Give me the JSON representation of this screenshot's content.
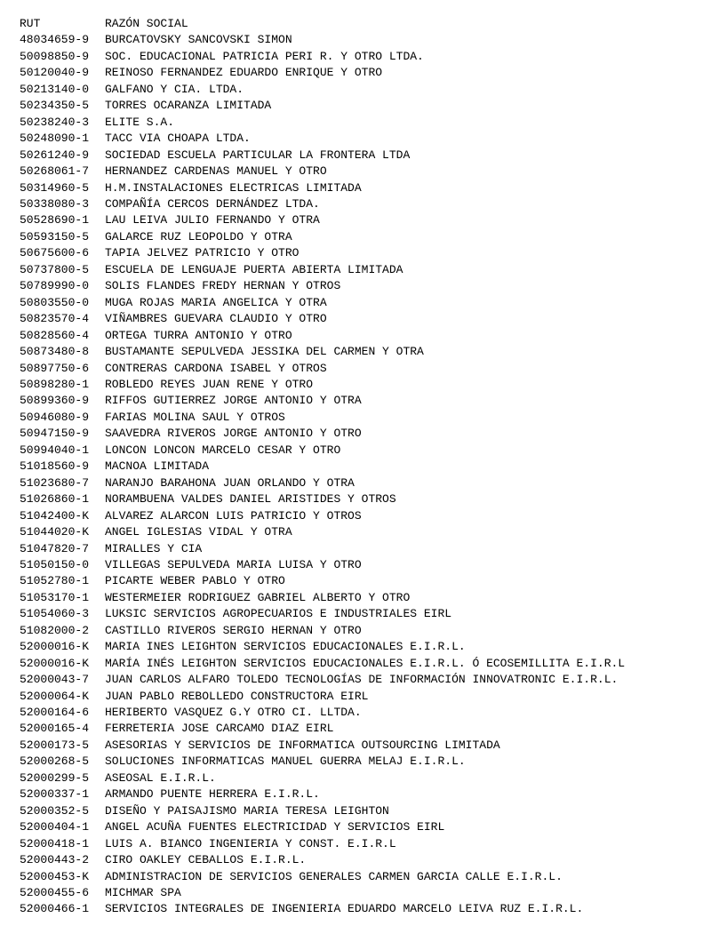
{
  "headers": {
    "rut": "RUT",
    "razon": "RAZÓN SOCIAL"
  },
  "rows": [
    {
      "rut": "48034659-9",
      "razon": "BURCATOVSKY SANCOVSKI SIMON"
    },
    {
      "rut": "50098850-9",
      "razon": "SOC. EDUCACIONAL PATRICIA PERI R. Y OTRO LTDA."
    },
    {
      "rut": "50120040-9",
      "razon": "REINOSO FERNANDEZ EDUARDO ENRIQUE Y OTRO"
    },
    {
      "rut": "50213140-0",
      "razon": "GALFANO Y CIA. LTDA."
    },
    {
      "rut": "50234350-5",
      "razon": "TORRES OCARANZA LIMITADA"
    },
    {
      "rut": "50238240-3",
      "razon": "ELITE S.A."
    },
    {
      "rut": "50248090-1",
      "razon": "TACC VIA CHOAPA LTDA."
    },
    {
      "rut": "50261240-9",
      "razon": "SOCIEDAD ESCUELA PARTICULAR LA FRONTERA LTDA"
    },
    {
      "rut": "50268061-7",
      "razon": "HERNANDEZ CARDENAS MANUEL Y OTRO"
    },
    {
      "rut": "50314960-5",
      "razon": "H.M.INSTALACIONES ELECTRICAS LIMITADA"
    },
    {
      "rut": "50338080-3",
      "razon": "COMPAÑÍA CERCOS DERNÁNDEZ LTDA."
    },
    {
      "rut": "50528690-1",
      "razon": "LAU LEIVA JULIO FERNANDO Y OTRA"
    },
    {
      "rut": "50593150-5",
      "razon": "GALARCE RUZ LEOPOLDO Y OTRA"
    },
    {
      "rut": "50675600-6",
      "razon": "TAPIA JELVEZ PATRICIO Y OTRO"
    },
    {
      "rut": "50737800-5",
      "razon": "ESCUELA DE LENGUAJE PUERTA ABIERTA LIMITADA"
    },
    {
      "rut": "50789990-0",
      "razon": "SOLIS FLANDES FREDY HERNAN Y OTROS"
    },
    {
      "rut": "50803550-0",
      "razon": "MUGA ROJAS MARIA ANGELICA Y OTRA"
    },
    {
      "rut": "50823570-4",
      "razon": "VIÑAMBRES GUEVARA CLAUDIO Y OTRO"
    },
    {
      "rut": "50828560-4",
      "razon": "ORTEGA TURRA ANTONIO Y OTRO"
    },
    {
      "rut": "50873480-8",
      "razon": "BUSTAMANTE SEPULVEDA JESSIKA DEL CARMEN Y OTRA"
    },
    {
      "rut": "50897750-6",
      "razon": "CONTRERAS CARDONA ISABEL Y OTROS"
    },
    {
      "rut": "50898280-1",
      "razon": "ROBLEDO REYES JUAN RENE Y OTRO"
    },
    {
      "rut": "50899360-9",
      "razon": "RIFFOS GUTIERREZ JORGE ANTONIO Y OTRA"
    },
    {
      "rut": "50946080-9",
      "razon": "FARIAS MOLINA SAUL Y OTROS"
    },
    {
      "rut": "50947150-9",
      "razon": "SAAVEDRA RIVEROS JORGE ANTONIO Y OTRO"
    },
    {
      "rut": "50994040-1",
      "razon": "LONCON LONCON MARCELO CESAR Y OTRO"
    },
    {
      "rut": "51018560-9",
      "razon": "MACNOA LIMITADA"
    },
    {
      "rut": "51023680-7",
      "razon": "NARANJO BARAHONA JUAN ORLANDO Y OTRA"
    },
    {
      "rut": "51026860-1",
      "razon": "NORAMBUENA VALDES DANIEL ARISTIDES Y OTROS"
    },
    {
      "rut": "51042400-K",
      "razon": "ALVAREZ ALARCON LUIS PATRICIO Y OTROS"
    },
    {
      "rut": "51044020-K",
      "razon": "ANGEL IGLESIAS VIDAL Y OTRA"
    },
    {
      "rut": "51047820-7",
      "razon": "MIRALLES Y CIA"
    },
    {
      "rut": "51050150-0",
      "razon": "VILLEGAS SEPULVEDA MARIA LUISA Y OTRO"
    },
    {
      "rut": "51052780-1",
      "razon": "PICARTE WEBER PABLO Y OTRO"
    },
    {
      "rut": "51053170-1",
      "razon": "WESTERMEIER RODRIGUEZ GABRIEL ALBERTO Y OTRO"
    },
    {
      "rut": "51054060-3",
      "razon": "LUKSIC SERVICIOS AGROPECUARIOS E INDUSTRIALES EIRL"
    },
    {
      "rut": "51082000-2",
      "razon": "CASTILLO RIVEROS SERGIO HERNAN  Y OTRO"
    },
    {
      "rut": "52000016-K",
      "razon": "MARIA INES LEIGHTON SERVICIOS EDUCACIONALES E.I.R.L."
    },
    {
      "rut": "52000016-K",
      "razon": "MARÍA INÉS LEIGHTON SERVICIOS EDUCACIONALES E.I.R.L. Ó ECOSEMILLITA E.I.R.L"
    },
    {
      "rut": "52000043-7",
      "razon": "JUAN CARLOS ALFARO TOLEDO TECNOLOGÍAS DE INFORMACIÓN INNOVATRONIC E.I.R.L."
    },
    {
      "rut": "52000064-K",
      "razon": "JUAN PABLO REBOLLEDO CONSTRUCTORA EIRL"
    },
    {
      "rut": "52000164-6",
      "razon": "HERIBERTO VASQUEZ G.Y OTRO CI. LLTDA."
    },
    {
      "rut": "52000165-4",
      "razon": "FERRETERIA JOSE CARCAMO DIAZ EIRL"
    },
    {
      "rut": "52000173-5",
      "razon": "ASESORIAS Y SERVICIOS DE INFORMATICA OUTSOURCING LIMITADA"
    },
    {
      "rut": "52000268-5",
      "razon": "SOLUCIONES INFORMATICAS MANUEL GUERRA MELAJ E.I.R.L."
    },
    {
      "rut": "52000299-5",
      "razon": "ASEOSAL E.I.R.L."
    },
    {
      "rut": "52000337-1",
      "razon": "ARMANDO PUENTE HERRERA E.I.R.L."
    },
    {
      "rut": "52000352-5",
      "razon": "DISEÑO Y PAISAJISMO MARIA TERESA LEIGHTON"
    },
    {
      "rut": "52000404-1",
      "razon": "ANGEL ACUÑA FUENTES ELECTRICIDAD Y SERVICIOS EIRL"
    },
    {
      "rut": "52000418-1",
      "razon": "LUIS A. BIANCO INGENIERIA Y CONST. E.I.R.L"
    },
    {
      "rut": "52000443-2",
      "razon": "CIRO OAKLEY CEBALLOS E.I.R.L."
    },
    {
      "rut": "52000453-K",
      "razon": "ADMINISTRACION DE SERVICIOS GENERALES CARMEN GARCIA CALLE E.I.R.L."
    },
    {
      "rut": "52000455-6",
      "razon": "MICHMAR SPA"
    },
    {
      "rut": "52000466-1",
      "razon": "SERVICIOS INTEGRALES DE INGENIERIA EDUARDO MARCELO LEIVA RUZ E.I.R.L."
    }
  ]
}
